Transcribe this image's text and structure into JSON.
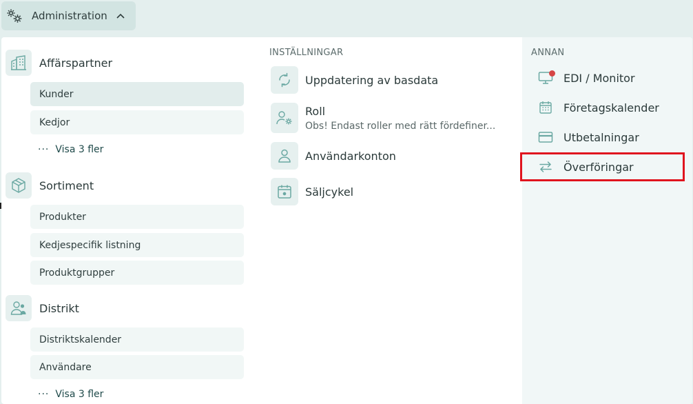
{
  "header": {
    "admin_label": "Administration",
    "admin_icon": "gears-icon",
    "chevron_icon": "chevron-up-icon"
  },
  "left": {
    "categories": [
      {
        "title": "Affärspartner",
        "icon": "buildings-icon",
        "items": [
          "Kunder",
          "Kedjor"
        ],
        "more": "Visa 3 fler"
      },
      {
        "title": "Sortiment",
        "icon": "box-icon",
        "items": [
          "Produkter",
          "Kedjespecifik listning",
          "Produktgrupper"
        ]
      },
      {
        "title": "Distrikt",
        "icon": "user-group-icon",
        "items": [
          "Distriktskalender",
          "Användare"
        ],
        "more": "Visa 3 fler"
      }
    ]
  },
  "middle": {
    "heading": "INSTÄLLNINGAR",
    "items": [
      {
        "title": "Uppdatering av basdata",
        "icon": "refresh-icon"
      },
      {
        "title": "Roll",
        "description": "Obs! Endast roller med rätt fördefiner...",
        "icon": "user-settings-icon"
      },
      {
        "title": "Användarkonton",
        "icon": "user-icon"
      },
      {
        "title": "Säljcykel",
        "icon": "calendar-icon"
      }
    ]
  },
  "right": {
    "heading": "ANNAN",
    "items": [
      {
        "label": "EDI / Monitor",
        "icon": "monitor-icon",
        "notification": true
      },
      {
        "label": "Företagskalender",
        "icon": "calendar-grid-icon"
      },
      {
        "label": "Utbetalningar",
        "icon": "card-icon"
      },
      {
        "label": "Överföringar",
        "icon": "transfer-arrows-icon"
      }
    ]
  },
  "colors": {
    "accent": "#6aa8a2",
    "notification": "#d64545",
    "highlight": "#e0141e"
  }
}
